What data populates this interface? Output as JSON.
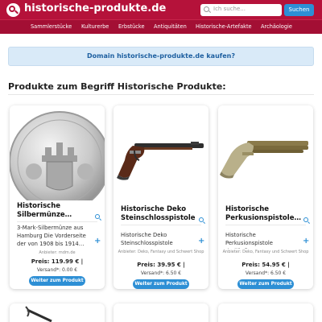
{
  "header": {
    "site_title": "historische-produkte.de",
    "search_placeholder": "Ich suche...",
    "search_button": "Suchen",
    "brand_color": "#b5123a",
    "accent_color": "#2d8fd5"
  },
  "nav": {
    "items": [
      "Sammlerstücke",
      "Kulturerbe",
      "Erbstücke",
      "Antiquitäten",
      "Historische-Artefakte",
      "Archäologie"
    ]
  },
  "banner": {
    "text": "Domain historische-produkte.de kaufen?"
  },
  "section_title": "Produkte zum Begriff Historische Produkte:",
  "products": [
    {
      "title": "Historische Silbermünze…",
      "description": "3-Mark-Silbermünze aus Hamburg Die Vorderseite der von 1908 bis 1914…",
      "seller": "Anbieter: mdm.de",
      "price": "Preis: 119.99 € |",
      "shipping": "Versand*: 0.00 €",
      "cta": "Weiter zum Produkt",
      "image_icon": "coin-image"
    },
    {
      "title": "Historische Deko Steinschlosspistole",
      "description": "Historische Deko Steinschlosspistole",
      "seller": "Anbieter: Deko, Fantasy und Schwert Shop",
      "price": "Preis: 39.95 € |",
      "shipping": "Versand*: 6.50 €",
      "cta": "Weiter zum Produkt",
      "image_icon": "flintlock-pistol-image"
    },
    {
      "title": "Historische Perkusionspistole…",
      "description": "Historische Perkusionspistole dreiläufig",
      "seller": "Anbieter: Deko, Fantasy und Schwert Shop",
      "price": "Preis: 54.95 € |",
      "shipping": "Versand*: 6.50 €",
      "cta": "Weiter zum Produkt",
      "image_icon": "percussion-pistol-image"
    }
  ]
}
